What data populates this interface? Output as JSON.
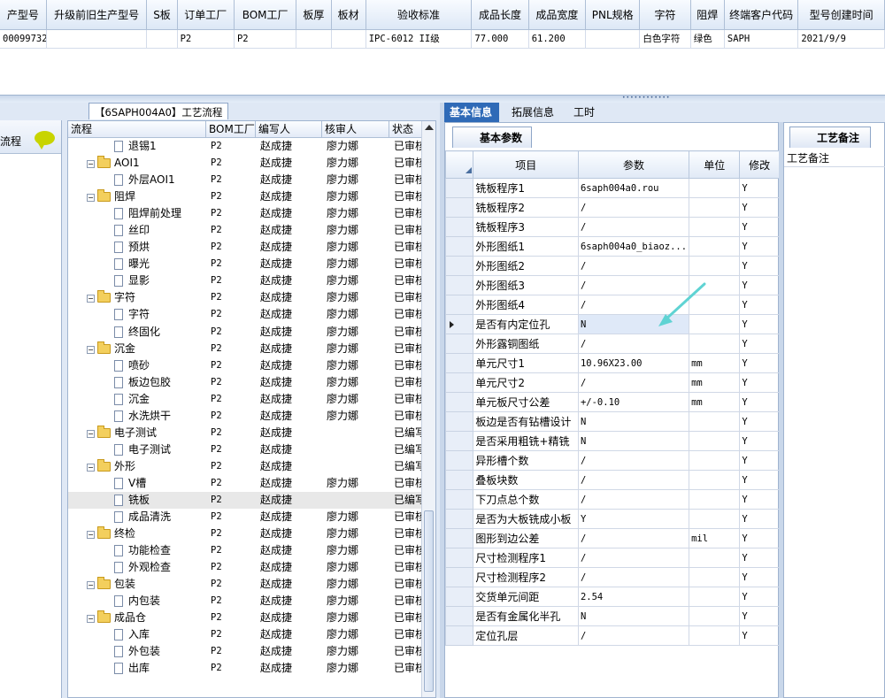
{
  "top_grid": {
    "headers": [
      "产型号",
      "升级前旧生产型号",
      "S板",
      "订单工厂",
      "BOM工厂",
      "板厚",
      "板材",
      "验收标准",
      "成品长度",
      "成品宽度",
      "PNL规格",
      "字符",
      "阻焊",
      "终端客户代码",
      "型号创建时间"
    ],
    "row": [
      "00099732",
      "",
      "",
      "P2",
      "P2",
      "",
      "",
      "IPC-6012 II级",
      "77.000",
      "61.200",
      "",
      "白色字符",
      "绿色",
      "SAPH",
      "2021/9/9"
    ]
  },
  "left_side": {
    "label": "流程"
  },
  "flow": {
    "title": "【6SAPH004A0】工艺流程",
    "columns": [
      "流程",
      "BOM工厂",
      "编写人",
      "核审人",
      "状态"
    ],
    "rows": [
      {
        "level": 2,
        "name": "退锡1",
        "factory": "P2",
        "writer": "赵成捷",
        "reviewer": "廖力娜",
        "status": "已审核"
      },
      {
        "level": 1,
        "name": "AOI1",
        "factory": "P2",
        "writer": "赵成捷",
        "reviewer": "廖力娜",
        "status": "已审核"
      },
      {
        "level": 2,
        "name": "外层AOI1",
        "factory": "P2",
        "writer": "赵成捷",
        "reviewer": "廖力娜",
        "status": "已审核"
      },
      {
        "level": 1,
        "name": "阻焊",
        "factory": "P2",
        "writer": "赵成捷",
        "reviewer": "廖力娜",
        "status": "已审核"
      },
      {
        "level": 2,
        "name": "阻焊前处理",
        "factory": "P2",
        "writer": "赵成捷",
        "reviewer": "廖力娜",
        "status": "已审核"
      },
      {
        "level": 2,
        "name": "丝印",
        "factory": "P2",
        "writer": "赵成捷",
        "reviewer": "廖力娜",
        "status": "已审核"
      },
      {
        "level": 2,
        "name": "预烘",
        "factory": "P2",
        "writer": "赵成捷",
        "reviewer": "廖力娜",
        "status": "已审核"
      },
      {
        "level": 2,
        "name": "曝光",
        "factory": "P2",
        "writer": "赵成捷",
        "reviewer": "廖力娜",
        "status": "已审核"
      },
      {
        "level": 2,
        "name": "显影",
        "factory": "P2",
        "writer": "赵成捷",
        "reviewer": "廖力娜",
        "status": "已审核"
      },
      {
        "level": 1,
        "name": "字符",
        "factory": "P2",
        "writer": "赵成捷",
        "reviewer": "廖力娜",
        "status": "已审核"
      },
      {
        "level": 2,
        "name": "字符",
        "factory": "P2",
        "writer": "赵成捷",
        "reviewer": "廖力娜",
        "status": "已审核"
      },
      {
        "level": 2,
        "name": "终固化",
        "factory": "P2",
        "writer": "赵成捷",
        "reviewer": "廖力娜",
        "status": "已审核"
      },
      {
        "level": 1,
        "name": "沉金",
        "factory": "P2",
        "writer": "赵成捷",
        "reviewer": "廖力娜",
        "status": "已审核"
      },
      {
        "level": 2,
        "name": "喷砂",
        "factory": "P2",
        "writer": "赵成捷",
        "reviewer": "廖力娜",
        "status": "已审核"
      },
      {
        "level": 2,
        "name": "板边包胶",
        "factory": "P2",
        "writer": "赵成捷",
        "reviewer": "廖力娜",
        "status": "已审核"
      },
      {
        "level": 2,
        "name": "沉金",
        "factory": "P2",
        "writer": "赵成捷",
        "reviewer": "廖力娜",
        "status": "已审核"
      },
      {
        "level": 2,
        "name": "水洗烘干",
        "factory": "P2",
        "writer": "赵成捷",
        "reviewer": "廖力娜",
        "status": "已审核"
      },
      {
        "level": 1,
        "name": "电子测试",
        "factory": "P2",
        "writer": "赵成捷",
        "reviewer": "",
        "status": "已编写"
      },
      {
        "level": 2,
        "name": "电子测试",
        "factory": "P2",
        "writer": "赵成捷",
        "reviewer": "",
        "status": "已编写"
      },
      {
        "level": 1,
        "name": "外形",
        "factory": "P2",
        "writer": "赵成捷",
        "reviewer": "",
        "status": "已编写"
      },
      {
        "level": 2,
        "name": "V槽",
        "factory": "P2",
        "writer": "赵成捷",
        "reviewer": "廖力娜",
        "status": "已审核"
      },
      {
        "level": 2,
        "name": "铣板",
        "factory": "P2",
        "writer": "赵成捷",
        "reviewer": "",
        "status": "已编写",
        "selected": true
      },
      {
        "level": 2,
        "name": "成品清洗",
        "factory": "P2",
        "writer": "赵成捷",
        "reviewer": "廖力娜",
        "status": "已审核"
      },
      {
        "level": 1,
        "name": "终检",
        "factory": "P2",
        "writer": "赵成捷",
        "reviewer": "廖力娜",
        "status": "已审核"
      },
      {
        "level": 2,
        "name": "功能检查",
        "factory": "P2",
        "writer": "赵成捷",
        "reviewer": "廖力娜",
        "status": "已审核"
      },
      {
        "level": 2,
        "name": "外观检查",
        "factory": "P2",
        "writer": "赵成捷",
        "reviewer": "廖力娜",
        "status": "已审核"
      },
      {
        "level": 1,
        "name": "包装",
        "factory": "P2",
        "writer": "赵成捷",
        "reviewer": "廖力娜",
        "status": "已审核"
      },
      {
        "level": 2,
        "name": "内包装",
        "factory": "P2",
        "writer": "赵成捷",
        "reviewer": "廖力娜",
        "status": "已审核"
      },
      {
        "level": 1,
        "name": "成品仓",
        "factory": "P2",
        "writer": "赵成捷",
        "reviewer": "廖力娜",
        "status": "已审核"
      },
      {
        "level": 2,
        "name": "入库",
        "factory": "P2",
        "writer": "赵成捷",
        "reviewer": "廖力娜",
        "status": "已审核"
      },
      {
        "level": 2,
        "name": "外包装",
        "factory": "P2",
        "writer": "赵成捷",
        "reviewer": "廖力娜",
        "status": "已审核"
      },
      {
        "level": 2,
        "name": "出库",
        "factory": "P2",
        "writer": "赵成捷",
        "reviewer": "廖力娜",
        "status": "已审核"
      }
    ]
  },
  "tabs": [
    "基本信息",
    "拓展信息",
    "工时"
  ],
  "params": {
    "subtab": "基本参数",
    "columns": [
      "项目",
      "参数",
      "单位",
      "修改"
    ],
    "rows": [
      {
        "item": "铣板程序1",
        "value": "6saph004a0.rou",
        "unit": "",
        "edit": "Y"
      },
      {
        "item": "铣板程序2",
        "value": "/",
        "unit": "",
        "edit": "Y"
      },
      {
        "item": "铣板程序3",
        "value": "/",
        "unit": "",
        "edit": "Y"
      },
      {
        "item": "外形图纸1",
        "value": "6saph004a0_biaoz...",
        "unit": "",
        "edit": "Y"
      },
      {
        "item": "外形图纸2",
        "value": "/",
        "unit": "",
        "edit": "Y"
      },
      {
        "item": "外形图纸3",
        "value": "/",
        "unit": "",
        "edit": "Y"
      },
      {
        "item": "外形图纸4",
        "value": "/",
        "unit": "",
        "edit": "Y"
      },
      {
        "item": "是否有内定位孔",
        "value": "N",
        "unit": "",
        "edit": "Y",
        "current": true
      },
      {
        "item": "外形露铜图纸",
        "value": "/",
        "unit": "",
        "edit": "Y"
      },
      {
        "item": "单元尺寸1",
        "value": "10.96X23.00",
        "unit": "mm",
        "edit": "Y"
      },
      {
        "item": "单元尺寸2",
        "value": "/",
        "unit": "mm",
        "edit": "Y"
      },
      {
        "item": "单元板尺寸公差",
        "value": "+/-0.10",
        "unit": "mm",
        "edit": "Y"
      },
      {
        "item": "板边是否有钻槽设计",
        "value": "N",
        "unit": "",
        "edit": "Y"
      },
      {
        "item": "是否采用粗铣+精铣",
        "value": "N",
        "unit": "",
        "edit": "Y"
      },
      {
        "item": "异形槽个数",
        "value": "/",
        "unit": "",
        "edit": "Y"
      },
      {
        "item": "叠板块数",
        "value": "/",
        "unit": "",
        "edit": "Y"
      },
      {
        "item": "下刀点总个数",
        "value": "/",
        "unit": "",
        "edit": "Y"
      },
      {
        "item": "是否为大板铣成小板",
        "value": "Y",
        "unit": "",
        "edit": "Y"
      },
      {
        "item": "图形到边公差",
        "value": "/",
        "unit": "mil",
        "edit": "Y"
      },
      {
        "item": "尺寸检测程序1",
        "value": "/",
        "unit": "",
        "edit": "Y"
      },
      {
        "item": "尺寸检测程序2",
        "value": "/",
        "unit": "",
        "edit": "Y"
      },
      {
        "item": "交货单元间距",
        "value": "2.54",
        "unit": "",
        "edit": "Y"
      },
      {
        "item": "是否有金属化半孔",
        "value": "N",
        "unit": "",
        "edit": "Y"
      },
      {
        "item": "定位孔层",
        "value": "/",
        "unit": "",
        "edit": "Y"
      }
    ]
  },
  "notes": {
    "tab": "工艺备注",
    "header": "工艺备注"
  },
  "icons": {
    "chat": "chat-bubble-icon",
    "folder": "folder-icon",
    "document": "document-icon",
    "arrow": "annotation-arrow-icon"
  },
  "colors": {
    "accent": "#2f6ab7",
    "folder": "#f3cf5d",
    "chat": "#c8d400",
    "arrow": "#5fd3d3"
  }
}
